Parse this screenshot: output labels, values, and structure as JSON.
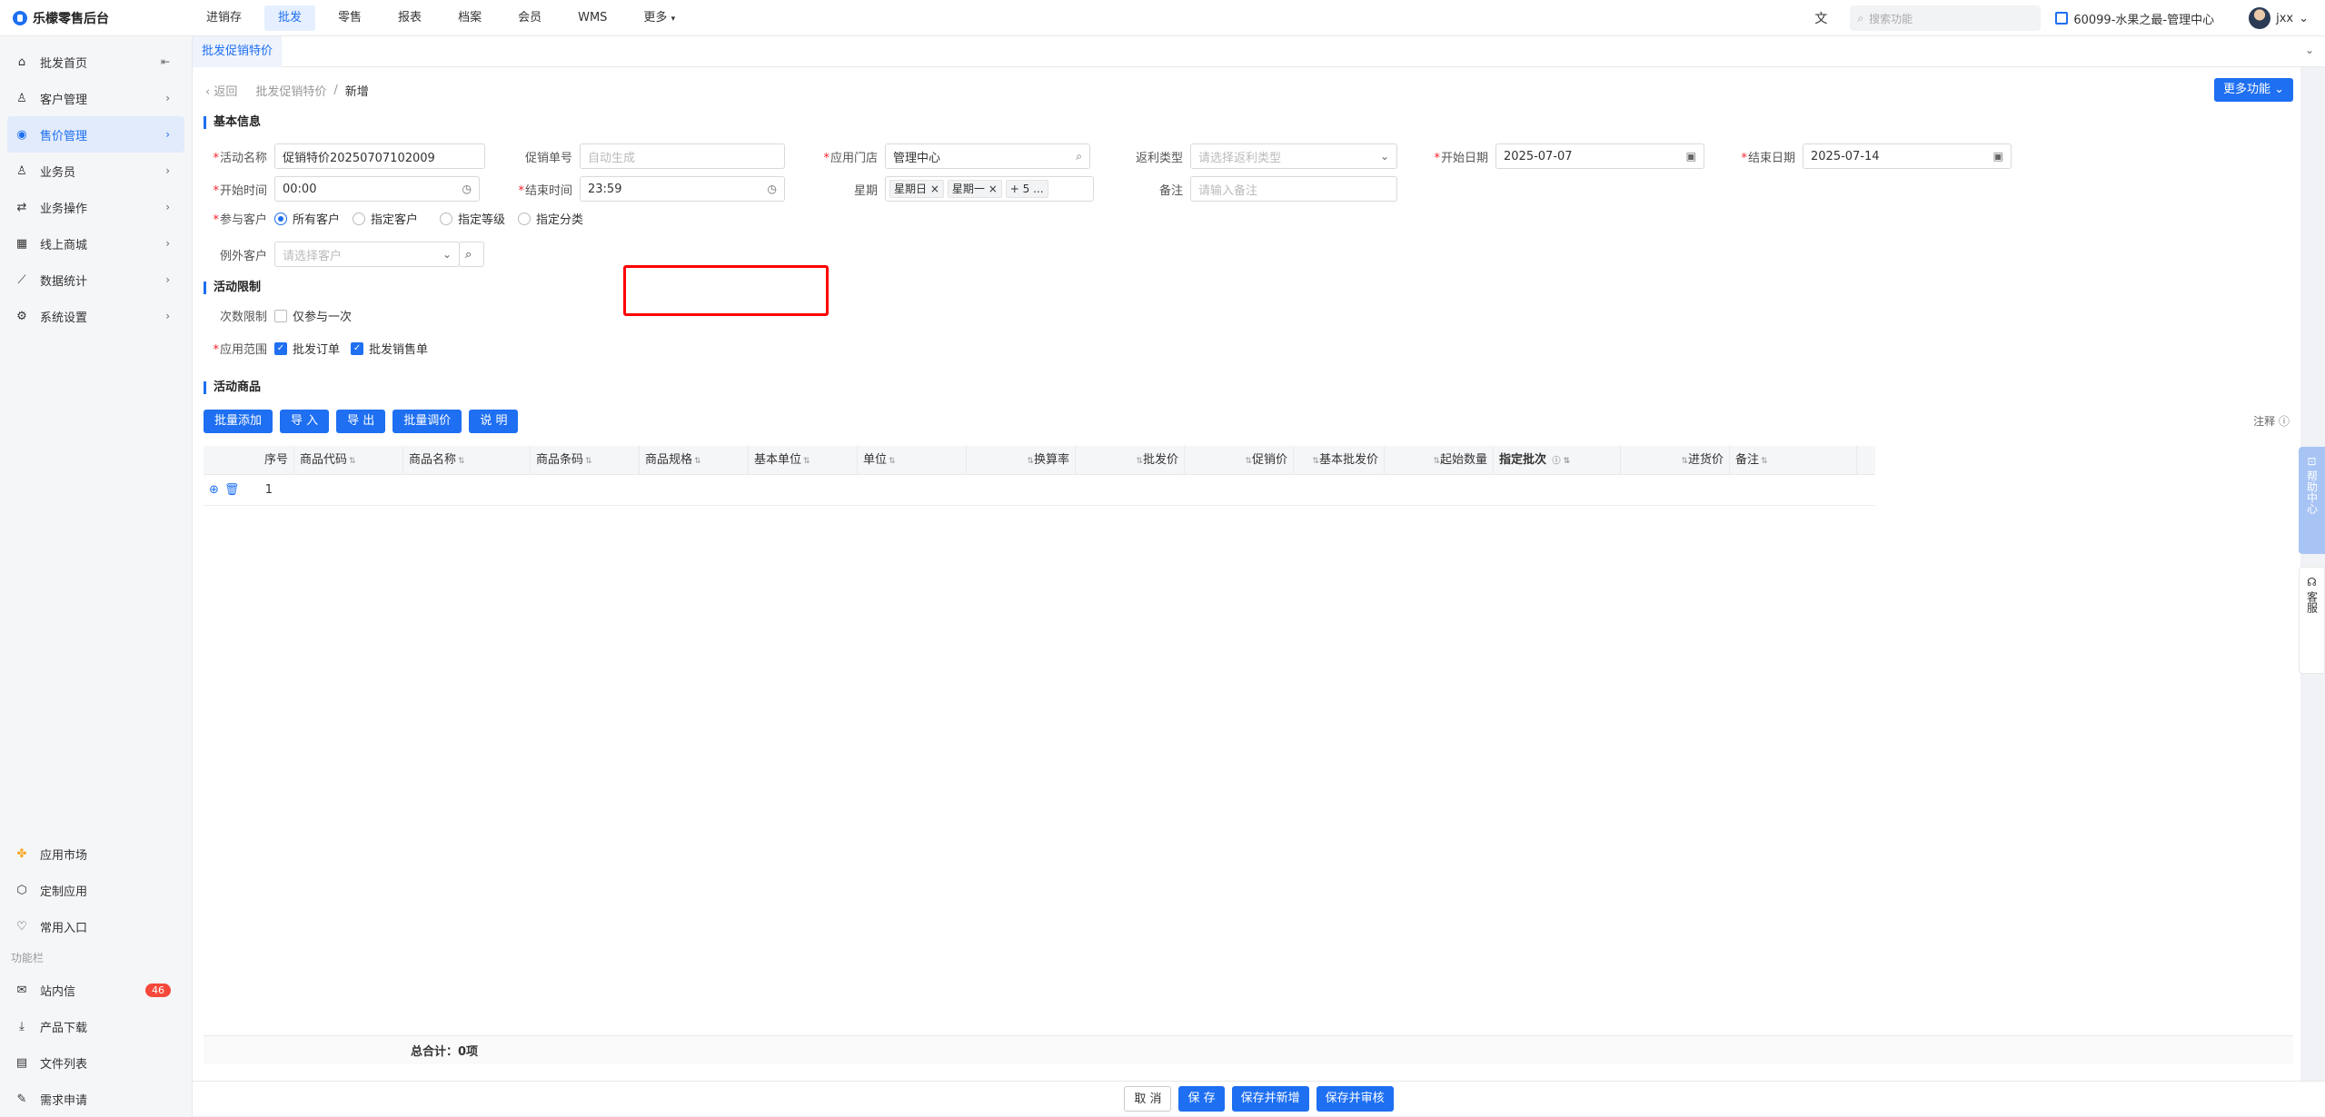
{
  "app": {
    "title": "乐檬零售后台"
  },
  "topnav": {
    "items": [
      "进销存",
      "批发",
      "零售",
      "报表",
      "档案",
      "会员",
      "WMS",
      "更多"
    ],
    "active_index": 1,
    "search_placeholder": "搜索功能",
    "store": "60099-水果之最-管理中心",
    "user": "jxx"
  },
  "sidebar": {
    "items": [
      "批发首页",
      "客户管理",
      "售价管理",
      "业务员",
      "业务操作",
      "线上商城",
      "数据统计",
      "系统设置"
    ],
    "active_index": 2,
    "bottom_items": [
      "应用市场",
      "定制应用",
      "常用入口"
    ],
    "section_label": "功能栏",
    "func_items": [
      "站内信",
      "产品下载",
      "文件列表",
      "需求申请"
    ],
    "unread_count": "46"
  },
  "tabs": {
    "current": "批发促销特价"
  },
  "breadcrumb": {
    "back": "返回",
    "parent": "批发促销特价",
    "sep": "/",
    "current": "新增"
  },
  "more_button": "更多功能",
  "basic": {
    "title": "基本信息",
    "activity_name_label": "活动名称",
    "activity_name": "促销特价20250707102009",
    "promo_no_label": "促销单号",
    "promo_no_placeholder": "自动生成",
    "store_label": "应用门店",
    "store_value": "管理中心",
    "rebate_label": "返利类型",
    "rebate_placeholder": "请选择返利类型",
    "start_date_label": "开始日期",
    "start_date": "2025-07-07",
    "end_date_label": "结束日期",
    "end_date": "2025-07-14",
    "start_time_label": "开始时间",
    "start_time": "00:00",
    "end_time_label": "结束时间",
    "end_time": "23:59",
    "weekday_label": "星期",
    "weekday_tag1": "星期日",
    "weekday_tag2": "星期一",
    "weekday_more": "+ 5 ...",
    "remark_label": "备注",
    "remark_placeholder": "请输入备注",
    "customer_label": "参与客户",
    "customer_options": [
      "所有客户",
      "指定客户",
      "指定等级",
      "指定分类"
    ],
    "customer_selected": 0,
    "except_label": "例外客户",
    "except_placeholder": "请选择客户"
  },
  "limit": {
    "title": "活动限制",
    "times_label": "次数限制",
    "times_option": "仅参与一次",
    "scope_label": "应用范围",
    "scope_options": [
      "批发订单",
      "批发销售单"
    ]
  },
  "goods": {
    "title": "活动商品",
    "buttons": [
      "批量添加",
      "导 入",
      "导 出",
      "批量调价",
      "说 明"
    ],
    "note": "注释",
    "columns": [
      "序号",
      "商品代码",
      "商品名称",
      "商品条码",
      "商品规格",
      "基本单位",
      "单位",
      "换算率",
      "批发价",
      "促销价",
      "基本批发价",
      "起始数量",
      "指定批次",
      "进货价",
      "备注"
    ],
    "rows": [
      {
        "idx": "1"
      }
    ],
    "total": "总合计：0项"
  },
  "side_widgets": {
    "help": "帮助中心",
    "service": "客服"
  },
  "actions": [
    "取 消",
    "保 存",
    "保存并新增",
    "保存并审核"
  ],
  "colors": {
    "accent": "#1e6ff1",
    "highlight": "#ff0000",
    "badge": "#f5483b"
  }
}
